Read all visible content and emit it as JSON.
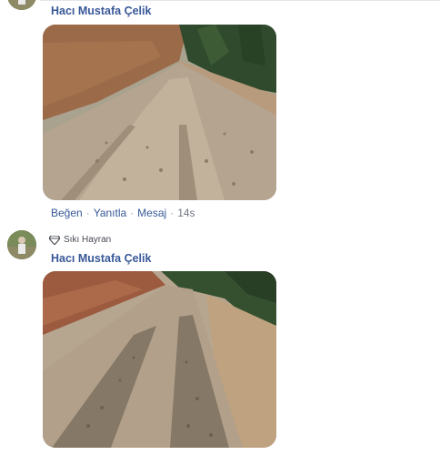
{
  "comments": [
    {
      "author": "Hacı Mustafa Çelik",
      "photo_icon": "dirt-road-photo",
      "actions": {
        "like": "Beğen",
        "reply": "Yanıtla",
        "message": "Mesaj",
        "time": "14s"
      }
    },
    {
      "badge_icon": "diamond-icon",
      "badge": "Sıkı Hayran",
      "author": "Hacı Mustafa Çelik",
      "photo_icon": "gravel-road-photo"
    }
  ],
  "separator": "·",
  "colors": {
    "author_link": "#385898",
    "meta_gray": "#6f7683",
    "divider": "#e4e6eb"
  }
}
